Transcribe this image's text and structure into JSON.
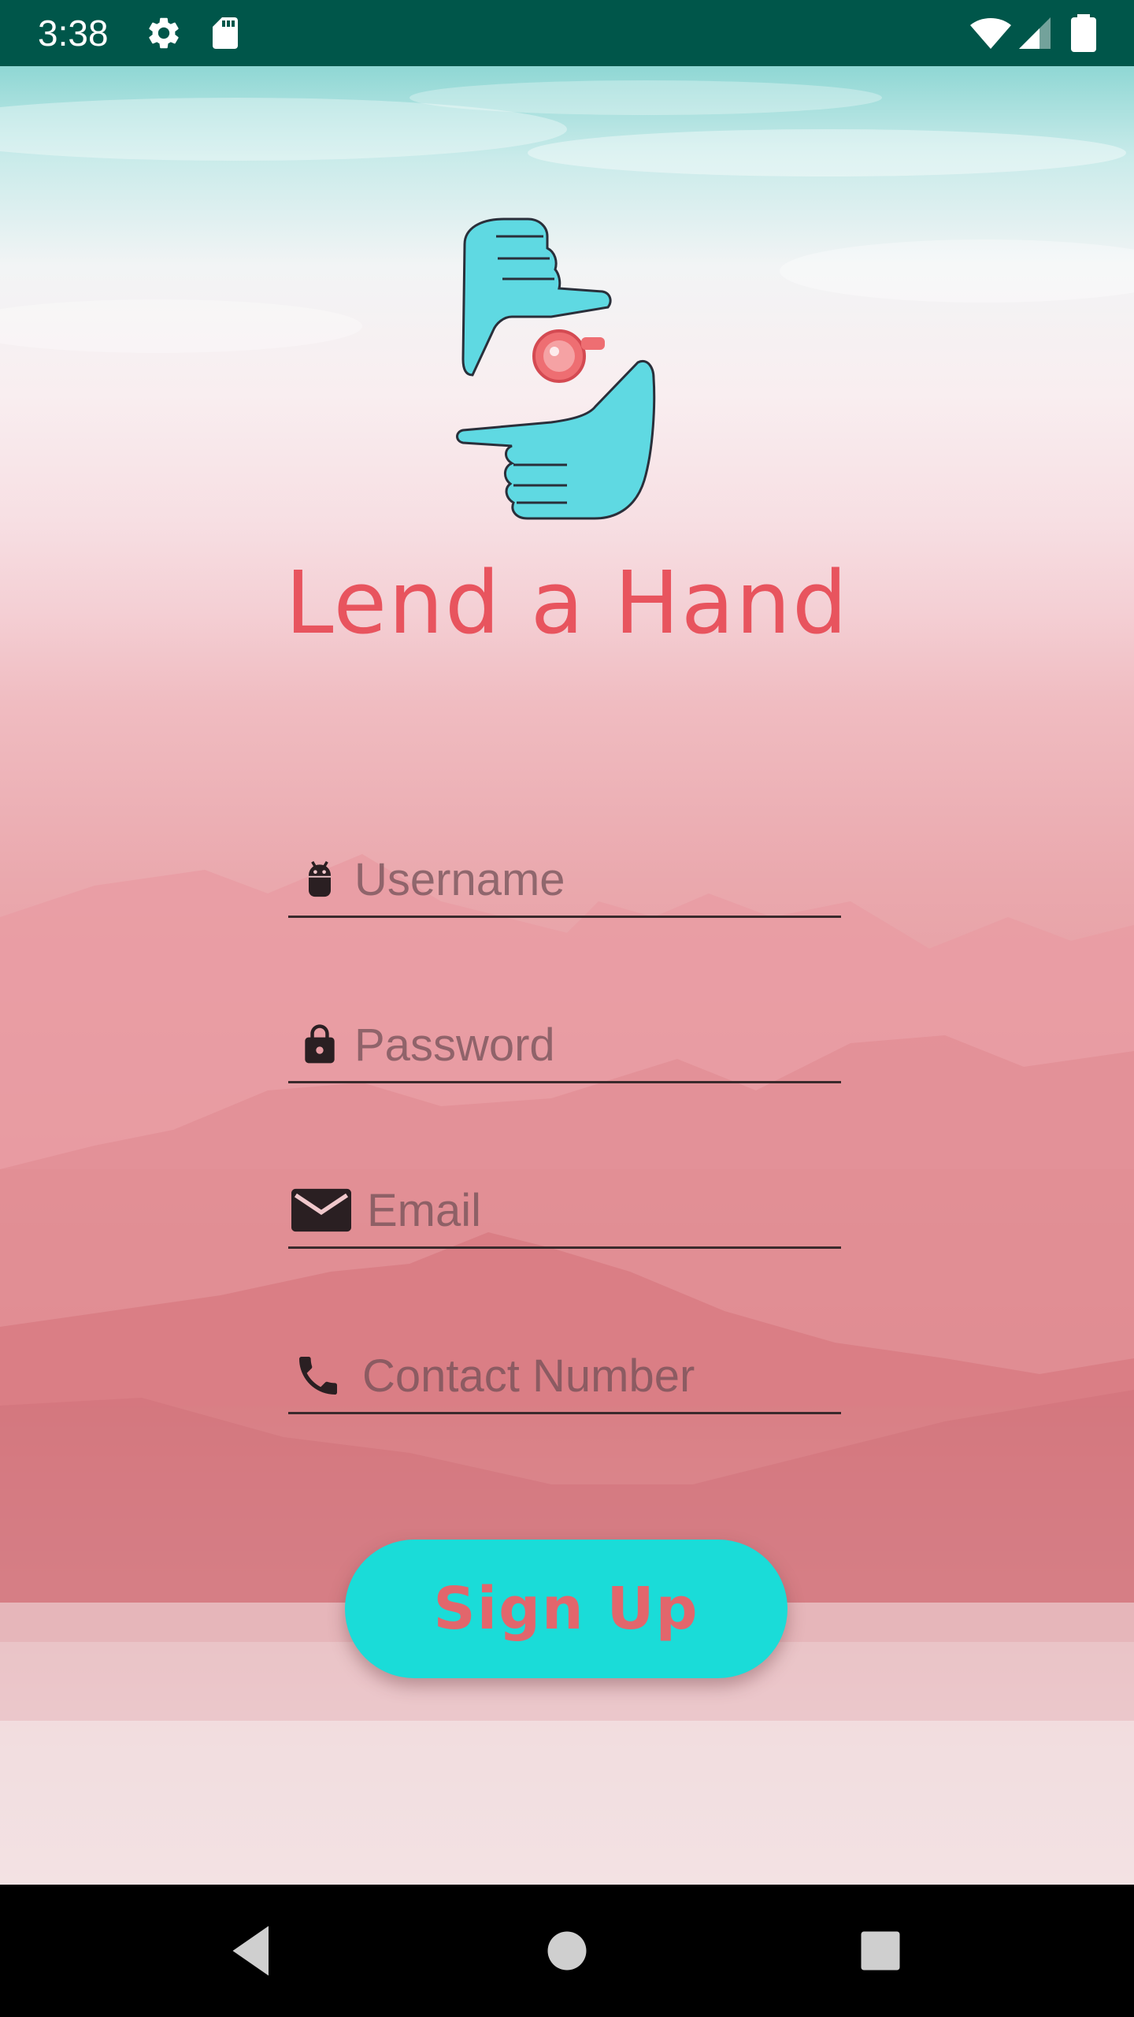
{
  "status_bar": {
    "time": "3:38",
    "icons": [
      "settings-icon",
      "sd-card-icon",
      "wifi-icon",
      "cell-signal-icon",
      "battery-icon"
    ],
    "background_color": "#00564a"
  },
  "brand": {
    "title": "Lend a Hand",
    "title_color": "#e8545e",
    "logo_icon": "hands-camera-logo"
  },
  "form": {
    "fields": [
      {
        "icon": "android-icon",
        "placeholder": "Username",
        "value": ""
      },
      {
        "icon": "lock-icon",
        "placeholder": "Password",
        "value": ""
      },
      {
        "icon": "email-icon",
        "placeholder": "Email",
        "value": ""
      },
      {
        "icon": "phone-icon",
        "placeholder": "Contact Number",
        "value": ""
      }
    ],
    "submit_label": "Sign Up",
    "submit_bg_color": "#1adcd8",
    "submit_text_color": "#e2666c"
  },
  "nav_bar": {
    "icons": [
      "back-icon",
      "home-icon",
      "recents-icon"
    ]
  }
}
